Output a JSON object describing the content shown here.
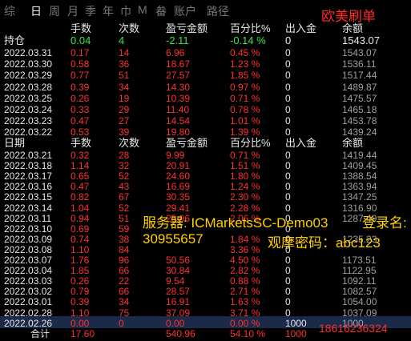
{
  "tabs": [
    {
      "label": "综"
    },
    {
      "label": "日",
      "active": true
    },
    {
      "label": "周"
    },
    {
      "label": "月"
    },
    {
      "label": "季"
    },
    {
      "label": "年"
    },
    {
      "label": "巾"
    },
    {
      "label": "M"
    },
    {
      "label": "畚"
    },
    {
      "label": "账户"
    },
    {
      "label": "路径"
    }
  ],
  "watermark": "欧美刷单",
  "header": {
    "c1": "",
    "c2": "手数",
    "c3": "次数",
    "c4": "盈亏金额",
    "c5": "百分比%",
    "c6": "出入金",
    "c7": "余额"
  },
  "holding": {
    "c1": "持仓",
    "c2": "0.04",
    "c3": "4",
    "c4": "-2.11",
    "c5": "-0.14 %",
    "c6": "0",
    "c7": "1543.07"
  },
  "rows_a": [
    {
      "d": "2022.03.31",
      "l": "0.17",
      "n": "14",
      "p": "6.96",
      "pct": "0.45 %",
      "io": "0",
      "bal": "1543.07"
    },
    {
      "d": "2022.03.30",
      "l": "0.58",
      "n": "36",
      "p": "18.67",
      "pct": "1.23 %",
      "io": "0",
      "bal": "1536.11"
    },
    {
      "d": "2022.03.29",
      "l": "0.77",
      "n": "51",
      "p": "27.57",
      "pct": "1.85 %",
      "io": "0",
      "bal": "1517.44"
    },
    {
      "d": "2022.03.28",
      "l": "0.39",
      "n": "34",
      "p": "14.30",
      "pct": "0.97 %",
      "io": "0",
      "bal": "1489.87"
    },
    {
      "d": "2022.03.25",
      "l": "0.26",
      "n": "19",
      "p": "10.39",
      "pct": "0.71 %",
      "io": "0",
      "bal": "1475.57"
    },
    {
      "d": "2022.03.24",
      "l": "0.33",
      "n": "29",
      "p": "11.40",
      "pct": "0.78 %",
      "io": "0",
      "bal": "1465.18"
    },
    {
      "d": "2022.03.23",
      "l": "0.47",
      "n": "27",
      "p": "14.54",
      "pct": "1.01 %",
      "io": "0",
      "bal": "1453.78"
    },
    {
      "d": "2022.03.22",
      "l": "0.53",
      "n": "39",
      "p": "19.80",
      "pct": "1.39 %",
      "io": "0",
      "bal": "1439.24"
    }
  ],
  "header2": {
    "c1": "日期",
    "c2": "手数",
    "c3": "次数",
    "c4": "盈亏金额",
    "c5": "百分比%",
    "c6": "出入金",
    "c7": "余额"
  },
  "rows_b": [
    {
      "d": "2022.03.21",
      "l": "0.32",
      "n": "28",
      "p": "9.99",
      "pct": "0.71 %",
      "io": "0",
      "bal": "1419.44"
    },
    {
      "d": "2022.03.18",
      "l": "1.14",
      "n": "32",
      "p": "20.91",
      "pct": "1.51 %",
      "io": "0",
      "bal": "1409.45"
    },
    {
      "d": "2022.03.17",
      "l": "0.65",
      "n": "52",
      "p": "24.60",
      "pct": "1.80 %",
      "io": "0",
      "bal": "1388.54"
    },
    {
      "d": "2022.03.16",
      "l": "0.47",
      "n": "43",
      "p": "16.69",
      "pct": "1.24 %",
      "io": "0",
      "bal": "1363.94"
    },
    {
      "d": "2022.03.15",
      "l": "0.82",
      "n": "67",
      "p": "30.35",
      "pct": "2.30 %",
      "io": "0",
      "bal": "1347.25"
    },
    {
      "d": "2022.03.14",
      "l": "1.04",
      "n": "52",
      "p": "29.41",
      "pct": "2.28 %",
      "io": "0",
      "bal": "1316.90"
    },
    {
      "d": "2022.03.11",
      "l": "0.94",
      "n": "51",
      "p": "25.96",
      "pct": "2.06 %",
      "io": "0",
      "bal": "1287.49"
    },
    {
      "d": "2022.03.10",
      "l": "0.69",
      "n": "59",
      "p": "",
      "pct": "",
      "io": "0",
      "bal": ""
    },
    {
      "d": "2022.03.09",
      "l": "0.74",
      "n": "38",
      "p": "",
      "pct": "1.84 %",
      "io": "0",
      "bal": "1235.23"
    },
    {
      "d": "2022.03.08",
      "l": "1.10",
      "n": "84",
      "p": "",
      "pct": "3.36 %",
      "io": "0",
      "bal": ""
    },
    {
      "d": "2022.03.07",
      "l": "1.76",
      "n": "96",
      "p": "50.56",
      "pct": "4.50 %",
      "io": "0",
      "bal": "1173.51"
    },
    {
      "d": "2022.03.04",
      "l": "1.85",
      "n": "66",
      "p": "30.84",
      "pct": "2.82 %",
      "io": "0",
      "bal": "1122.95"
    },
    {
      "d": "2022.03.03",
      "l": "0.26",
      "n": "22",
      "p": "9.54",
      "pct": "0.88 %",
      "io": "0",
      "bal": "1092.11"
    },
    {
      "d": "2022.03.02",
      "l": "0.79",
      "n": "66",
      "p": "28.57",
      "pct": "2.71 %",
      "io": "0",
      "bal": "1082.57"
    },
    {
      "d": "2022.03.01",
      "l": "0.39",
      "n": "34",
      "p": "16.91",
      "pct": "1.63 %",
      "io": "0",
      "bal": "1054.00"
    },
    {
      "d": "2022.02.28",
      "l": "1.10",
      "n": "75",
      "p": "37.09",
      "pct": "3.71 %",
      "io": "0",
      "bal": "1037.09"
    },
    {
      "d": "2022.02.26",
      "l": "0.00",
      "n": "0",
      "p": "0.00",
      "pct": "0.00 %",
      "io": "1000",
      "bal": "1000"
    }
  ],
  "total": {
    "label": "合计",
    "l": "17.60",
    "p": "540.96",
    "pct": "54.10 %",
    "io": "1000"
  },
  "overlay": {
    "line1": "服务器: ICMarketsSC-Demo03",
    "line1b": "登录名:",
    "line2": "30955657",
    "line2b": "观摩密码：abc123"
  },
  "phone": "18616236324"
}
